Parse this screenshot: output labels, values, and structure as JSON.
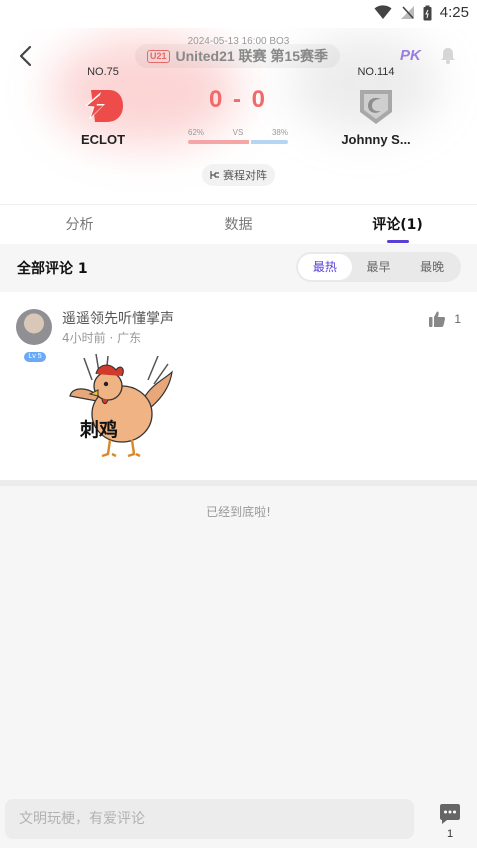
{
  "status_bar": {
    "time": "4:25",
    "icons": [
      "wifi-icon",
      "signal-off-icon",
      "battery-icon"
    ]
  },
  "match": {
    "date": "2024-05-13 16:00 BO3",
    "league_logo": "U21",
    "league": "United21 联赛 第15赛季",
    "pk_label": "PK",
    "score_home": "0",
    "score_sep": "-",
    "score_away": "0",
    "vote": {
      "home_pct": "62%",
      "vs": "VS",
      "away_pct": "38%",
      "home_fraction": 0.62
    },
    "schedule_button": "赛程对阵",
    "home": {
      "rank": "NO.75",
      "name": "ECLOT"
    },
    "away": {
      "rank": "NO.114",
      "name": "Johnny S..."
    }
  },
  "tabs": [
    {
      "label": "分析",
      "active": false
    },
    {
      "label": "数据",
      "active": false
    },
    {
      "label": "评论(1)",
      "active": true
    }
  ],
  "comments_header": {
    "title": "全部评论",
    "count": "1",
    "sort_options": [
      "最热",
      "最早",
      "最晚"
    ],
    "active_sort": "最热"
  },
  "comment": {
    "level": "Lv 5",
    "user": "遥遥领先听懂掌声",
    "meta": "4小时前 · 广东",
    "likes": "1",
    "sticker_text": "刺鸡"
  },
  "end_text": "已经到底啦!",
  "bottom": {
    "placeholder": "文明玩梗，有爱评论",
    "comment_count": "1"
  },
  "colors": {
    "accent": "#5a3fd6",
    "score": "#f06a6a",
    "home_logo": "#ee4b4b",
    "vote_home": "#f5a5a5",
    "vote_away": "#b5d6f2"
  }
}
